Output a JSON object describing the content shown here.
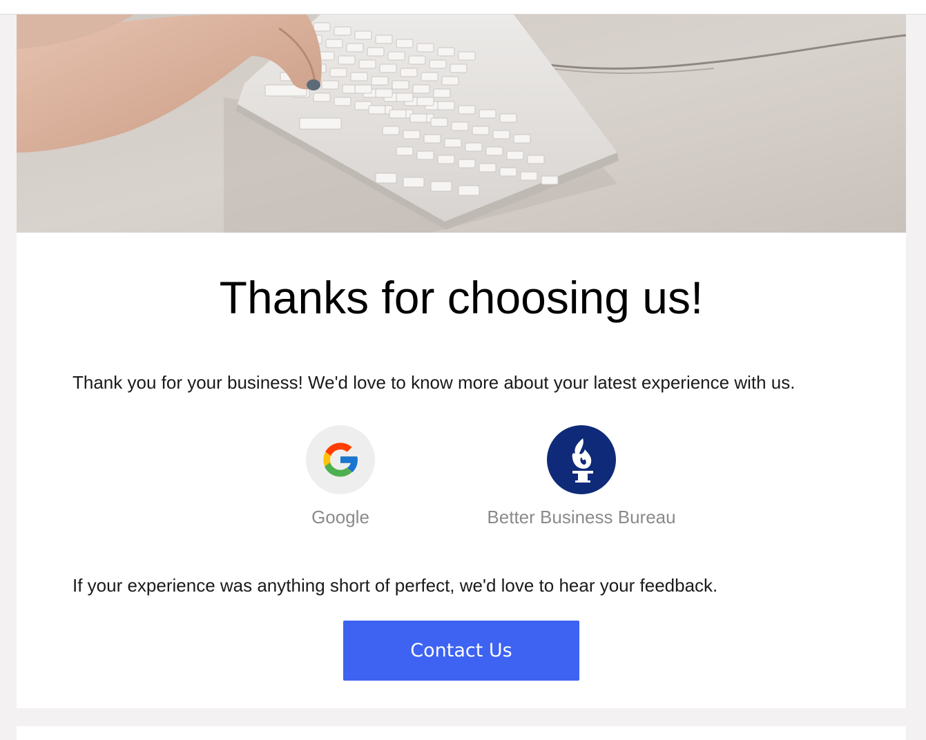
{
  "email": {
    "heading": "Thanks for choosing us!",
    "intro_text": "Thank you for your business! We'd love to know more about your latest experience with us.",
    "review_sites": [
      {
        "label": "Google",
        "icon": "google-g-logo"
      },
      {
        "label": "Better Business Bureau",
        "icon": "bbb-torch-logo"
      }
    ],
    "feedback_text": "If your experience was anything short of perfect, we'd love to hear your feedback.",
    "contact_button_label": "Contact Us"
  },
  "colors": {
    "button": "#3e63f2",
    "bbb_circle": "#0f2a78",
    "google_circle": "#eeeeee",
    "page_background": "#f3f1f1"
  }
}
